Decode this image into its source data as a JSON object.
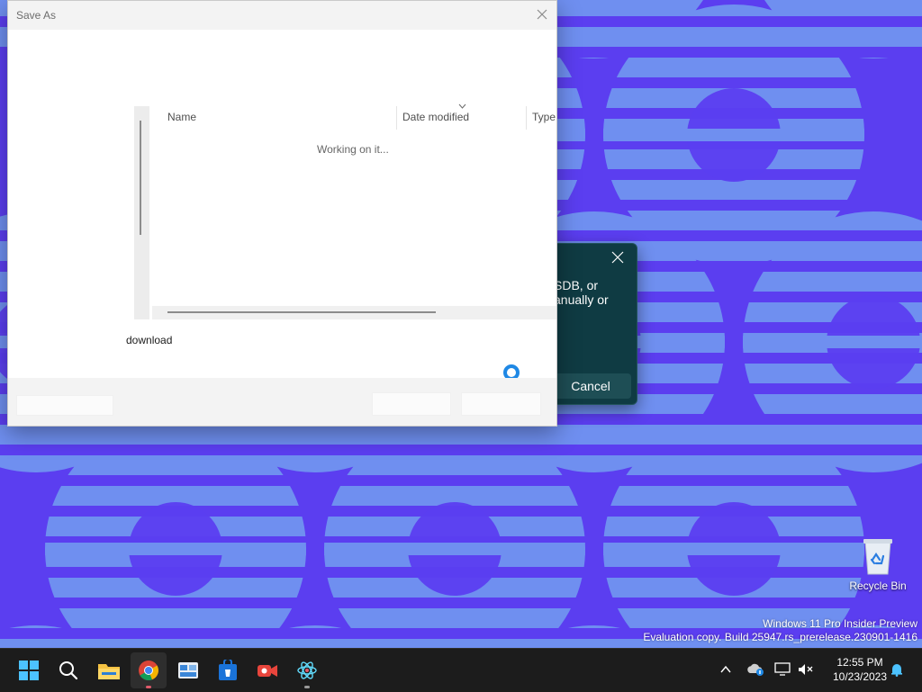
{
  "desktop": {
    "watermark": {
      "line1": "Windows 11 Pro Insider Preview",
      "line2": "Evaluation copy. Build 25947.rs_prerelease.230901-1416"
    },
    "icons": [
      {
        "label": "Recycle Bin",
        "icon": "recycle-bin-icon"
      }
    ],
    "colors": {
      "wallpaper_base": "#5b3ef0",
      "wallpaper_shape": "#6f8ff0"
    }
  },
  "background_dialog": {
    "message_line1": "SDB, or",
    "message_line2": "anually or",
    "cancel_label": "Cancel",
    "close_icon": "close-icon"
  },
  "save_as_dialog": {
    "title": "Save As",
    "columns": [
      "Name",
      "Date modified",
      "Type"
    ],
    "status_text": "Working on it...",
    "file_name": "download",
    "busy_icon": "spinner-icon"
  },
  "taskbar": {
    "apps": [
      {
        "name": "Start",
        "icon": "windows-start-icon"
      },
      {
        "name": "Search",
        "icon": "search-icon"
      },
      {
        "name": "File Explorer",
        "icon": "folder-icon"
      },
      {
        "name": "Google Chrome",
        "icon": "chrome-icon",
        "active": true
      },
      {
        "name": "Widgets",
        "icon": "widgets-icon"
      },
      {
        "name": "Microsoft Store",
        "icon": "store-icon"
      },
      {
        "name": "Camera",
        "icon": "camera-icon"
      },
      {
        "name": "React app",
        "icon": "atom-icon"
      }
    ],
    "clock": {
      "time": "12:55 PM",
      "date": "10/23/2023"
    }
  }
}
